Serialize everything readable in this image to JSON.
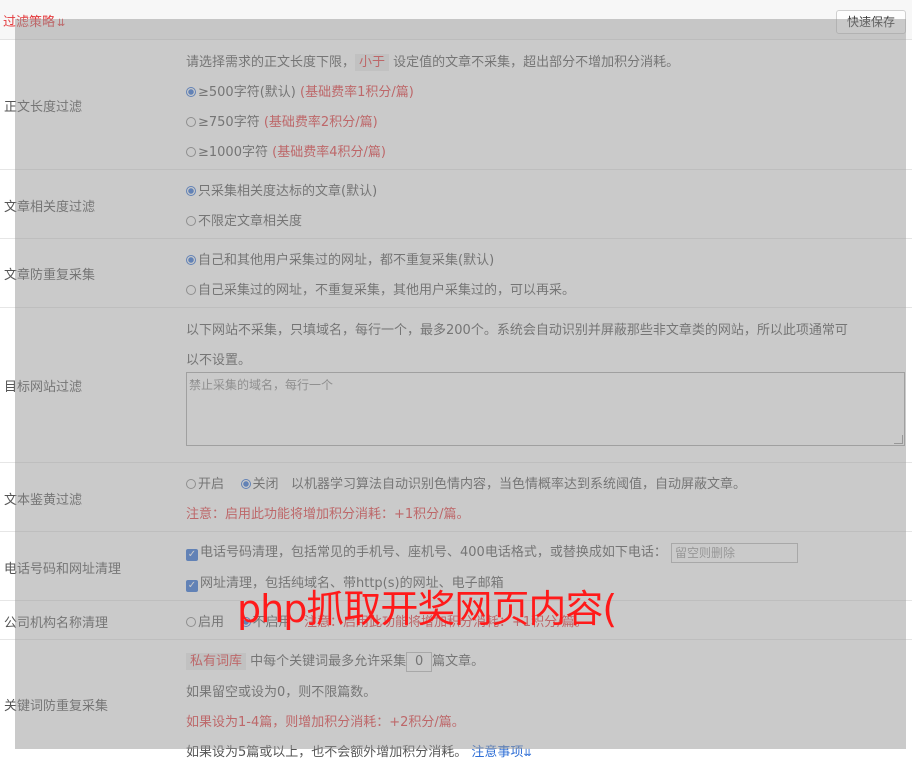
{
  "header": {
    "title": "过滤策略",
    "title_icon": "chevron-double-down-icon",
    "save_label": "快速保存"
  },
  "length_filter": {
    "label": "正文长度过滤",
    "desc_pre": "请选择需求的正文长度下限，",
    "desc_tag": "小于",
    "desc_post": "设定值的文章不采集，超出部分不增加积分消耗。",
    "options": [
      {
        "text": "≥500字符(默认)",
        "note": "(基础费率1积分/篇)",
        "checked": true
      },
      {
        "text": "≥750字符",
        "note": "(基础费率2积分/篇)",
        "checked": false
      },
      {
        "text": "≥1000字符",
        "note": "(基础费率4积分/篇)",
        "checked": false
      }
    ]
  },
  "relevance": {
    "label": "文章相关度过滤",
    "options": [
      {
        "text": "只采集相关度达标的文章(默认)",
        "checked": true
      },
      {
        "text": "不限定文章相关度",
        "checked": false
      }
    ]
  },
  "dedup": {
    "label": "文章防重复采集",
    "options": [
      {
        "text": "自己和其他用户采集过的网址，都不重复采集(默认)",
        "checked": true
      },
      {
        "text": "自己采集过的网址，不重复采集，其他用户采集过的，可以再采。",
        "checked": false
      }
    ]
  },
  "site_filter": {
    "label": "目标网站过滤",
    "desc_line1": "以下网站不采集，只填域名，每行一个，最多200个。系统会自动识别并屏蔽那些非文章类的网站，所以此项通常可",
    "desc_line2": "以不设置。",
    "placeholder": "禁止采集的域名，每行一个"
  },
  "porn_filter": {
    "label": "文本鉴黄过滤",
    "on_label": "开启",
    "off_label": "关闭",
    "desc": "以机器学习算法自动识别色情内容，当色情概率达到系统阈值，自动屏蔽文章。",
    "note": "注意：启用此功能将增加积分消耗：+1积分/篇。"
  },
  "contact_clean": {
    "label": "电话号码和网址清理",
    "phone_text": "电话号码清理，包括常见的手机号、座机号、400电话格式，或替换成如下电话：",
    "phone_placeholder": "留空则删除",
    "url_text": "网址清理，包括纯域名、带http(s)的网址、电子邮箱"
  },
  "company_clean": {
    "label": "公司机构名称清理",
    "on_label": "启用",
    "off_label": "不启用",
    "note": "注意：启用此功能将增加积分消耗：+1积分/篇。"
  },
  "keyword_dedup": {
    "label": "关键词防重复采集",
    "tag": "私有词库",
    "line1_mid": "中每个关键词最多允许采集",
    "max_count": "0",
    "line1_post": "篇文章。",
    "line2": "如果留空或设为0，则不限篇数。",
    "line3": "如果设为1-4篇，则增加积分消耗：+2积分/篇。",
    "line4": "如果设为5篇或以上，也不会额外增加积分消耗。",
    "notes_link": "注意事项"
  },
  "overlay_banner": "php抓取开奖网页内容("
}
